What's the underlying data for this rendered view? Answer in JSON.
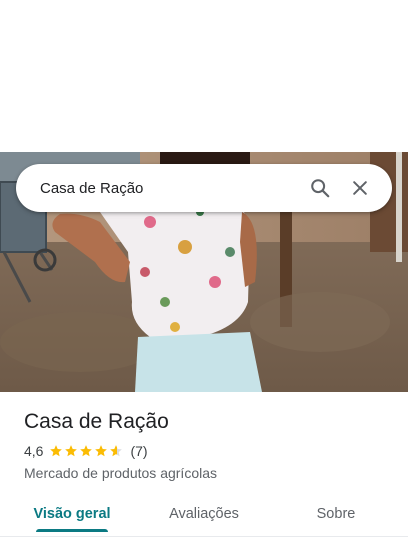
{
  "search": {
    "query": "Casa de Ração",
    "search_icon": "search-icon",
    "close_icon": "close-icon"
  },
  "hero_photo": {
    "icon": "place-photo"
  },
  "place": {
    "title": "Casa de Ração",
    "rating_value": "4,6",
    "rating": 4.6,
    "rating_max": 5,
    "review_count": "(7)",
    "category": "Mercado de produtos agrícolas"
  },
  "tabs": [
    {
      "label": "Visão geral",
      "active": true
    },
    {
      "label": "Avaliações",
      "active": false
    },
    {
      "label": "Sobre",
      "active": false
    }
  ],
  "colors": {
    "accent": "#0b7a83",
    "star": "#fbbc04",
    "text": "#202124",
    "secondary_text": "#5f6368"
  }
}
